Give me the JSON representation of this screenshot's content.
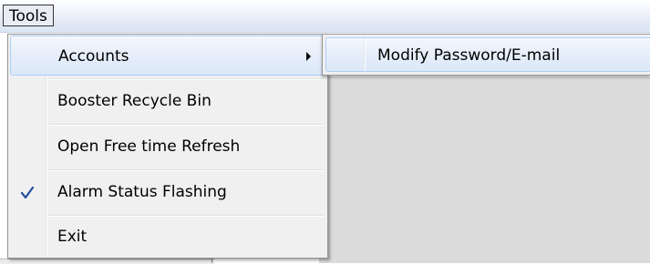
{
  "menubar": {
    "tools_label": "Tools"
  },
  "menu": {
    "items": [
      {
        "label": "Accounts",
        "has_submenu": true,
        "highlighted": true
      },
      {
        "label": "Booster Recycle Bin"
      },
      {
        "label": "Open Free time Refresh"
      },
      {
        "label": "Alarm Status Flashing",
        "checked": true,
        "check_icon": "checkmark-icon"
      },
      {
        "label": "Exit"
      }
    ]
  },
  "submenu": {
    "items": [
      {
        "label": "Modify Password/E-mail",
        "highlighted": true
      }
    ]
  },
  "colors": {
    "highlight_border": "#aecff7",
    "checkmark": "#1f4fa0",
    "menu_background": "#f0f0f0",
    "workspace": "#dbdbdb"
  }
}
